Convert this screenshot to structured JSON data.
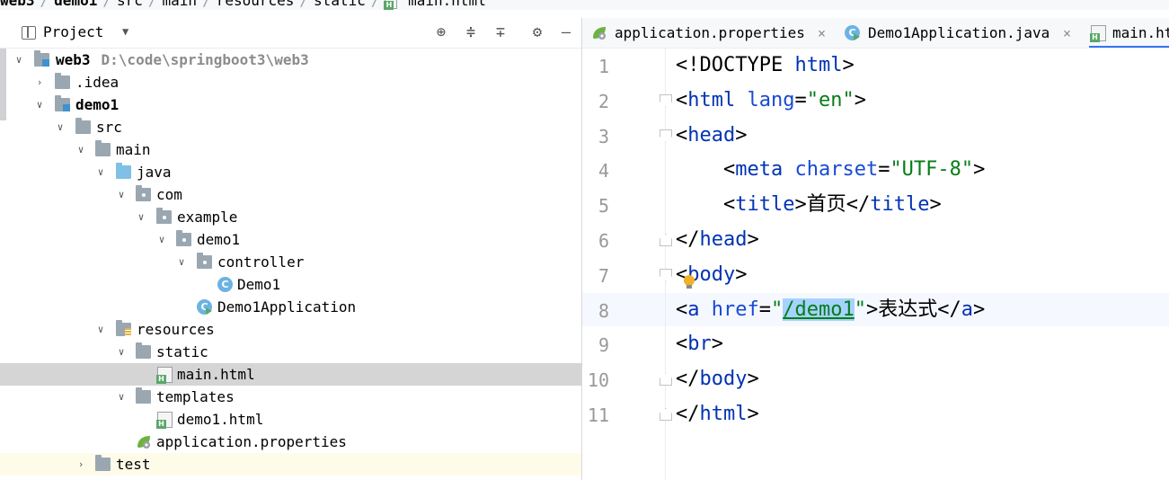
{
  "breadcrumb": {
    "items": [
      "web3",
      "demo1",
      "src",
      "main",
      "resources",
      "static",
      "main.html"
    ]
  },
  "project_panel": {
    "title": "Project",
    "tree": [
      {
        "label": "web3",
        "path": "D:\\code\\springboot3\\web3"
      },
      {
        "label": ".idea"
      },
      {
        "label": "demo1"
      },
      {
        "label": "src"
      },
      {
        "label": "main"
      },
      {
        "label": "java"
      },
      {
        "label": "com"
      },
      {
        "label": "example"
      },
      {
        "label": "demo1"
      },
      {
        "label": "controller"
      },
      {
        "label": "Demo1"
      },
      {
        "label": "Demo1Application"
      },
      {
        "label": "resources"
      },
      {
        "label": "static"
      },
      {
        "label": "main.html"
      },
      {
        "label": "templates"
      },
      {
        "label": "demo1.html"
      },
      {
        "label": "application.properties"
      },
      {
        "label": "test"
      }
    ]
  },
  "editor": {
    "tabs": [
      {
        "label": "application.properties"
      },
      {
        "label": "Demo1Application.java"
      },
      {
        "label": "main.html"
      }
    ],
    "line_numbers": [
      "1",
      "2",
      "3",
      "4",
      "5",
      "6",
      "7",
      "8",
      "9",
      "10",
      "11"
    ],
    "lines": [
      [
        [
          "p",
          "<!DOCTYPE "
        ],
        [
          "t",
          "html"
        ],
        [
          "p",
          ">"
        ]
      ],
      [
        [
          "p",
          "<"
        ],
        [
          "t",
          "html"
        ],
        [
          "p",
          " "
        ],
        [
          "a",
          "lang"
        ],
        [
          "p",
          "="
        ],
        [
          "v",
          "\"en\""
        ],
        [
          "p",
          ">"
        ]
      ],
      [
        [
          "p",
          "<"
        ],
        [
          "t",
          "head"
        ],
        [
          "p",
          ">"
        ]
      ],
      [
        [
          "p",
          "    <"
        ],
        [
          "t",
          "meta"
        ],
        [
          "p",
          " "
        ],
        [
          "a",
          "charset"
        ],
        [
          "p",
          "="
        ],
        [
          "v",
          "\"UTF-8\""
        ],
        [
          "p",
          ">"
        ]
      ],
      [
        [
          "p",
          "    <"
        ],
        [
          "t",
          "title"
        ],
        [
          "p",
          ">首页</"
        ],
        [
          "t",
          "title"
        ],
        [
          "p",
          ">"
        ]
      ],
      [
        [
          "p",
          "</"
        ],
        [
          "t",
          "head"
        ],
        [
          "p",
          ">"
        ]
      ],
      [
        [
          "p",
          "<"
        ],
        [
          "t",
          "body"
        ],
        [
          "p",
          ">"
        ]
      ],
      [
        [
          "p",
          "<"
        ],
        [
          "t",
          "a"
        ],
        [
          "p",
          " "
        ],
        [
          "a",
          "href"
        ],
        [
          "p",
          "="
        ],
        [
          "v",
          "\""
        ],
        [
          "vlink",
          "/demo1"
        ],
        [
          "v",
          "\""
        ],
        [
          "p",
          ">表达式</"
        ],
        [
          "t",
          "a"
        ],
        [
          "p",
          ">"
        ]
      ],
      [
        [
          "p",
          "<"
        ],
        [
          "t",
          "br"
        ],
        [
          "p",
          ">"
        ]
      ],
      [
        [
          "p",
          "</"
        ],
        [
          "t",
          "body"
        ],
        [
          "p",
          ">"
        ]
      ],
      [
        [
          "p",
          "</"
        ],
        [
          "t",
          "html"
        ],
        [
          "p",
          ">"
        ]
      ]
    ]
  },
  "colors": {
    "tag": "#0033b3",
    "attribute": "#174ad4",
    "string": "#067d17",
    "selection": "#a6d2ff",
    "active_tab_underline": "#3574f0"
  }
}
